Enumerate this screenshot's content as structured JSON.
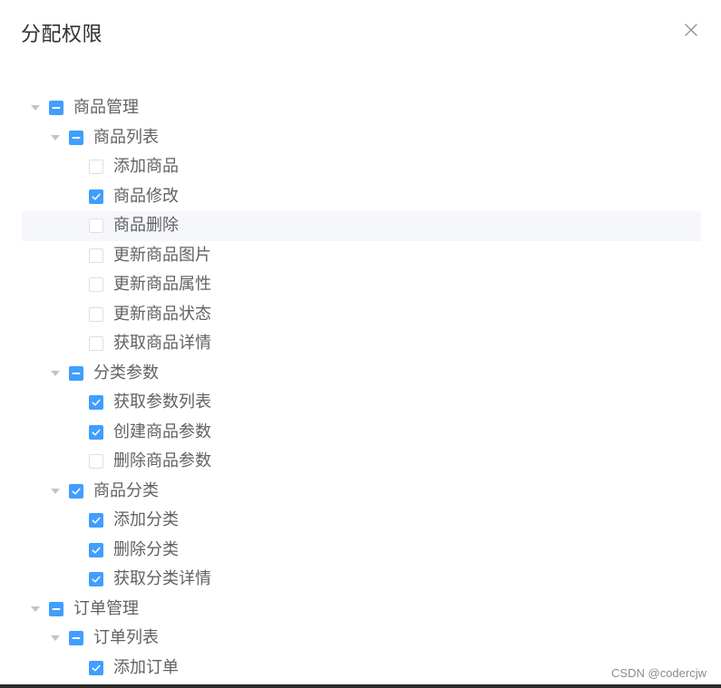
{
  "dialog": {
    "title": "分配权限",
    "close_icon": "close-icon"
  },
  "colors": {
    "primary": "#409eff",
    "text": "#606266",
    "title": "#303133",
    "border": "#dcdfe6",
    "hover_bg": "#f5f7fa",
    "caret": "#c0c4cc"
  },
  "tree": [
    {
      "label": "商品管理",
      "level": 0,
      "state": "indeterminate",
      "expandable": true
    },
    {
      "label": "商品列表",
      "level": 1,
      "state": "indeterminate",
      "expandable": true
    },
    {
      "label": "添加商品",
      "level": 2,
      "state": "unchecked",
      "expandable": false
    },
    {
      "label": "商品修改",
      "level": 2,
      "state": "checked",
      "expandable": false
    },
    {
      "label": "商品删除",
      "level": 2,
      "state": "unchecked",
      "expandable": false,
      "hover": true
    },
    {
      "label": "更新商品图片",
      "level": 2,
      "state": "unchecked",
      "expandable": false
    },
    {
      "label": "更新商品属性",
      "level": 2,
      "state": "unchecked",
      "expandable": false
    },
    {
      "label": "更新商品状态",
      "level": 2,
      "state": "unchecked",
      "expandable": false
    },
    {
      "label": "获取商品详情",
      "level": 2,
      "state": "unchecked",
      "expandable": false
    },
    {
      "label": "分类参数",
      "level": 1,
      "state": "indeterminate",
      "expandable": true
    },
    {
      "label": "获取参数列表",
      "level": 2,
      "state": "checked",
      "expandable": false
    },
    {
      "label": "创建商品参数",
      "level": 2,
      "state": "checked",
      "expandable": false
    },
    {
      "label": "删除商品参数",
      "level": 2,
      "state": "unchecked",
      "expandable": false
    },
    {
      "label": "商品分类",
      "level": 1,
      "state": "checked",
      "expandable": true
    },
    {
      "label": "添加分类",
      "level": 2,
      "state": "checked",
      "expandable": false
    },
    {
      "label": "删除分类",
      "level": 2,
      "state": "checked",
      "expandable": false
    },
    {
      "label": "获取分类详情",
      "level": 2,
      "state": "checked",
      "expandable": false
    },
    {
      "label": "订单管理",
      "level": 0,
      "state": "indeterminate",
      "expandable": true
    },
    {
      "label": "订单列表",
      "level": 1,
      "state": "indeterminate",
      "expandable": true
    },
    {
      "label": "添加订单",
      "level": 2,
      "state": "checked",
      "expandable": false
    }
  ],
  "watermark": "CSDN @codercjw"
}
